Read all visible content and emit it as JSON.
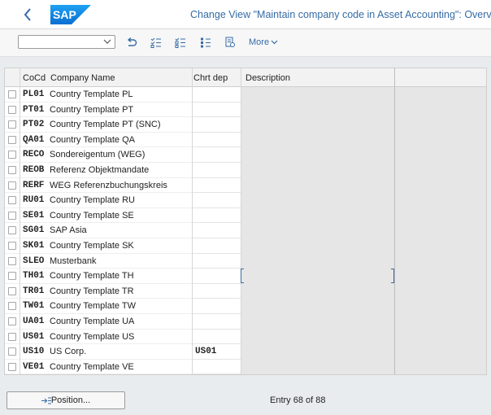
{
  "header": {
    "title": "Change View \"Maintain company code in Asset Accounting\": Overview",
    "logo_text": "SAP",
    "brand_color": "#0a6ed1"
  },
  "toolbar": {
    "dropdown_value": "",
    "more_label": "More",
    "icons": [
      "undo-icon",
      "select-all-icon",
      "deselect-all-icon",
      "select-block-icon",
      "print-icon"
    ]
  },
  "table": {
    "headers": {
      "cocd": "CoCd",
      "company": "Company Name",
      "chrt": "Chrt dep",
      "description": "Description"
    },
    "rows": [
      {
        "cocd": "PL01",
        "name": "Country Template PL",
        "chrt": ""
      },
      {
        "cocd": "PT01",
        "name": "Country Template PT",
        "chrt": ""
      },
      {
        "cocd": "PT02",
        "name": "Country Template PT (SNC)",
        "chrt": ""
      },
      {
        "cocd": "QA01",
        "name": "Country Template QA",
        "chrt": ""
      },
      {
        "cocd": "RECO",
        "name": "Sondereigentum (WEG)",
        "chrt": ""
      },
      {
        "cocd": "REOB",
        "name": "Referenz Objektmandate",
        "chrt": ""
      },
      {
        "cocd": "RERF",
        "name": "WEG Referenzbuchungskreis",
        "chrt": ""
      },
      {
        "cocd": "RU01",
        "name": "Country Template RU",
        "chrt": ""
      },
      {
        "cocd": "SE01",
        "name": "Country Template SE",
        "chrt": ""
      },
      {
        "cocd": "SG01",
        "name": "SAP Asia",
        "chrt": ""
      },
      {
        "cocd": "SK01",
        "name": "Country Template SK",
        "chrt": ""
      },
      {
        "cocd": "SLEO",
        "name": "Musterbank",
        "chrt": ""
      },
      {
        "cocd": "TH01",
        "name": "Country Template TH",
        "chrt": ""
      },
      {
        "cocd": "TR01",
        "name": "Country Template TR",
        "chrt": ""
      },
      {
        "cocd": "TW01",
        "name": "Country Template TW",
        "chrt": ""
      },
      {
        "cocd": "UA01",
        "name": "Country Template UA",
        "chrt": ""
      },
      {
        "cocd": "US01",
        "name": "Country Template US",
        "chrt": ""
      },
      {
        "cocd": "US10",
        "name": "US Corp.",
        "chrt": "US01"
      },
      {
        "cocd": "VE01",
        "name": "Country Template VE",
        "chrt": ""
      }
    ]
  },
  "footer": {
    "position_label": "Position...",
    "entry_text": "Entry 68 of 88"
  }
}
